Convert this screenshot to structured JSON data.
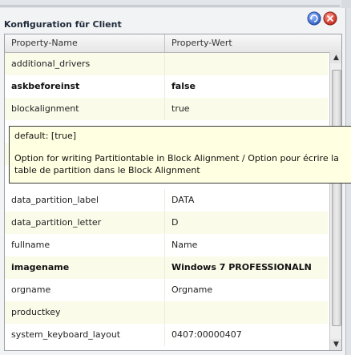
{
  "panel": {
    "title": "Konfiguration für Client"
  },
  "icons": {
    "reload": "reload-blue-icon",
    "delete": "delete-red-icon"
  },
  "colors": {
    "row_tint": "#fbfbea",
    "tooltip_bg": "#ffffe1",
    "reload": "#3f6fd6",
    "delete": "#d9483b"
  },
  "table": {
    "headers": [
      "Property-Name",
      "Property-Wert"
    ],
    "rows": [
      {
        "name": "additional_drivers",
        "value": "",
        "bold": false
      },
      {
        "name": "askbeforeinst",
        "value": "false",
        "bold": true
      },
      {
        "name": "blockalignment",
        "value": "true",
        "bold": false
      },
      {
        "name": "data_partition_label",
        "value": "DATA",
        "bold": false
      },
      {
        "name": "data_partition_letter",
        "value": "D",
        "bold": false
      },
      {
        "name": "fullname",
        "value": "Name",
        "bold": false
      },
      {
        "name": "imagename",
        "value": "Windows 7 PROFESSIONALN",
        "bold": true
      },
      {
        "name": "orgname",
        "value": "Orgname",
        "bold": false
      },
      {
        "name": "productkey",
        "value": "",
        "bold": false
      },
      {
        "name": "system_keyboard_layout",
        "value": "0407:00000407",
        "bold": false
      }
    ]
  },
  "tooltip": {
    "default": "default: [true]",
    "description": "Option for writing Partitiontable in Block Alignment / Option pour écrire la table de partition dans le Block Alignment"
  },
  "scrollbar": {
    "up": "▲",
    "down": "▼"
  }
}
